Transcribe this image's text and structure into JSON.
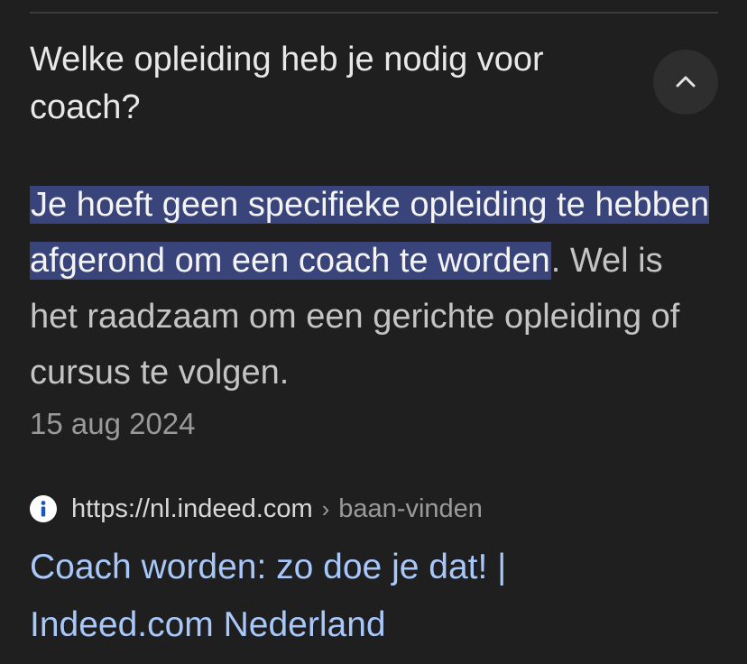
{
  "question": "Welke opleiding heb je nodig voor coach?",
  "answer": {
    "highlighted": "Je hoeft geen specifieke opleiding te hebben afgerond om een coach te worden",
    "rest": ". Wel is het raadzaam om een gerichte opleiding of cursus te volgen."
  },
  "date": "15 aug 2024",
  "source": {
    "url": "https://nl.indeed.com",
    "separator": "›",
    "path": "baan-vinden",
    "icon": "info-icon"
  },
  "result_title": "Coach worden: zo doe je dat! | Indeed.com Nederland",
  "collapse_icon": "chevron-up-icon",
  "colors": {
    "background": "#1f1f1f",
    "highlight": "#39447a",
    "link": "#a8c7fa"
  }
}
